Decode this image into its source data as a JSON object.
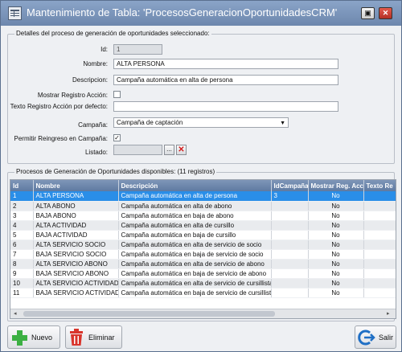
{
  "window": {
    "title": "Mantenimiento de Tabla: 'ProcesosGeneracionOportunidadesCRM'"
  },
  "details": {
    "legend": "Detalles del proceso de generación de oportunidades seleccionado:",
    "id_label": "Id:",
    "id_value": "1",
    "nombre_label": "Nombre:",
    "nombre_value": "ALTA PERSONA",
    "descripcion_label": "Descripcion:",
    "descripcion_value": "Campaña automática en alta de persona",
    "mostrar_label": "Mostrar Registro Acción:",
    "mostrar_checked": false,
    "texto_label": "Texto Registro Acción por defecto:",
    "texto_value": "",
    "campana_label": "Campaña:",
    "campana_value": "Campaña de captación",
    "reingreso_label": "Permitir Reingreso en Campaña:",
    "reingreso_checked": true,
    "listado_label": "Listado:",
    "listado_value": "",
    "browse_label": "...",
    "clear_label": "✕"
  },
  "grid": {
    "legend": "Procesos de Generación de Oportunidades disponibles:  (11 registros)",
    "columns": [
      "Id",
      "Nombre",
      "Descripción",
      "IdCampaña",
      "Mostrar Reg. Acc.",
      "Texto Re"
    ],
    "rows": [
      [
        "1",
        "ALTA PERSONA",
        "Campaña automática en alta de persona",
        "3",
        "No",
        ""
      ],
      [
        "2",
        "ALTA ABONO",
        "Campaña automática en alta de abono",
        "",
        "No",
        ""
      ],
      [
        "3",
        "BAJA ABONO",
        "Campaña automática en baja de abono",
        "",
        "No",
        ""
      ],
      [
        "4",
        "ALTA ACTIVIDAD",
        "Campaña automática en alta de cursillo",
        "",
        "No",
        ""
      ],
      [
        "5",
        "BAJA ACTIVIDAD",
        "Campaña automática en baja de cursillo",
        "",
        "No",
        ""
      ],
      [
        "6",
        "ALTA SERVICIO SOCIO",
        "Campaña automática en alta de servicio de socio",
        "",
        "No",
        ""
      ],
      [
        "7",
        "BAJA SERVICIO SOCIO",
        "Campaña automática en baja de servicio de socio",
        "",
        "No",
        ""
      ],
      [
        "8",
        "ALTA SERVICIO ABONO",
        "Campaña automática en alta de servicio de abono",
        "",
        "No",
        ""
      ],
      [
        "9",
        "BAJA SERVICIO ABONO",
        "Campaña automática en baja de servicio de abono",
        "",
        "No",
        ""
      ],
      [
        "10",
        "ALTA SERVICIO ACTIVIDAD",
        "Campaña automática en alta de servicio de cursillista",
        "",
        "No",
        ""
      ],
      [
        "11",
        "BAJA SERVICIO ACTIVIDAD",
        "Campaña automática en baja de servicio de cursillista",
        "",
        "No",
        ""
      ]
    ],
    "selected_row": 0
  },
  "buttons": {
    "nuevo": "Nuevo",
    "eliminar": "Eliminar",
    "salir": "Salir"
  },
  "colors": {
    "titlebar": "#6d87ad",
    "header": "#5f7aa1",
    "selection": "#2a8ee8",
    "nuevo_icon": "#3cb043",
    "eliminar_icon": "#d9342b",
    "salir_icon": "#1f6fc5"
  },
  "icons": {
    "window": "table-icon",
    "nuevo": "plus-icon",
    "eliminar": "trash-icon",
    "salir": "exit-icon"
  }
}
